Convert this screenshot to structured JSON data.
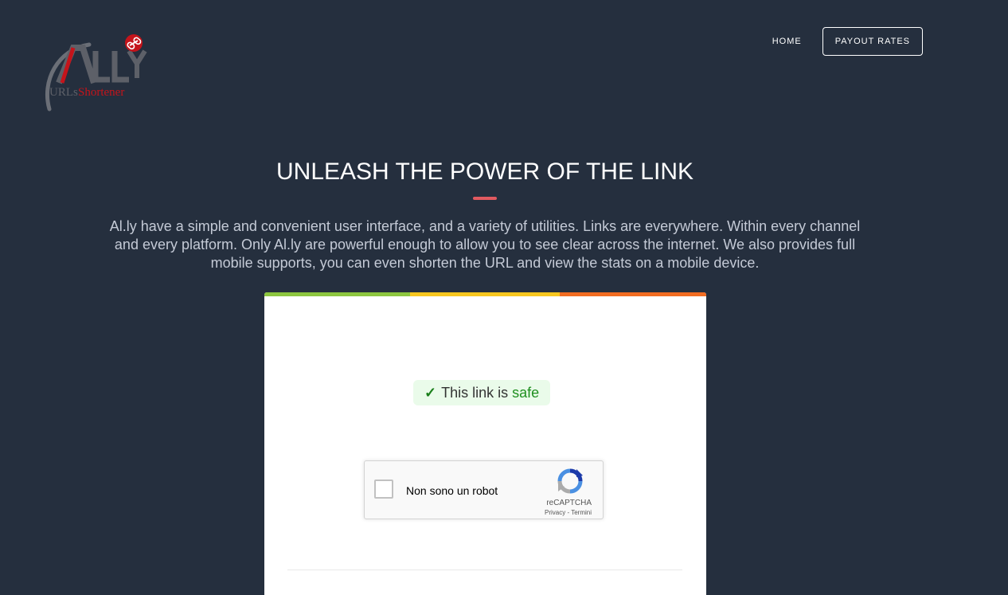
{
  "logo": {
    "wordmark": "ALLY",
    "tagline_part1": "URLs",
    "tagline_part2": "Shortener",
    "icon": "link-icon"
  },
  "nav": {
    "home": "HOME",
    "payout_rates": "PAYOUT RATES"
  },
  "hero": {
    "title": "UNLEASH THE POWER OF THE LINK",
    "description": "Al.ly have a simple and convenient user interface, and a variety of utilities. Links are everywhere. Within every channel and every platform. Only Al.ly are powerful enough to allow you to see clear across the internet. We also provides full mobile supports, you can even shorten the URL and view the stats on a mobile device."
  },
  "card": {
    "safe_badge": {
      "check": "✓",
      "prefix": "This link is",
      "safe_word": "safe"
    },
    "recaptcha": {
      "label": "Non sono un robot",
      "brand": "reCAPTCHA",
      "links": "Privacy - Termini"
    }
  },
  "colors": {
    "background": "#252f3e",
    "accent": "#e15a60",
    "bar_green": "#8dc63f",
    "bar_yellow": "#f8c71f",
    "bar_orange": "#f26c21",
    "safe_green": "#1f8f1f"
  }
}
